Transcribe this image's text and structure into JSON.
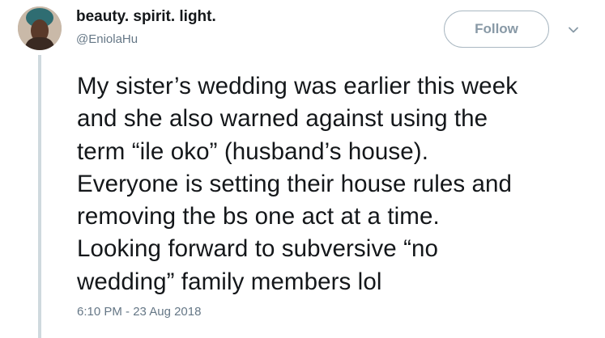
{
  "author": {
    "display_name": "beauty. spirit. light.",
    "handle": "@EniolaHu",
    "avatar_icon": "profile-photo"
  },
  "actions": {
    "follow_label": "Follow",
    "menu_icon": "chevron-down-icon"
  },
  "tweet": {
    "lines": [
      "My sister’s wedding was earlier this week",
      "and she also warned against using the",
      "term “ile oko” (husband’s house).",
      "Everyone is setting their house rules and",
      "removing the bs one act at a time.",
      "Looking forward to subversive “no",
      "wedding” family members lol"
    ],
    "timestamp": "6:10 PM - 23 Aug 2018"
  },
  "colors": {
    "text_primary": "#14171a",
    "text_secondary": "#657786",
    "thread_line": "#cfd9de",
    "follow_border": "#aab8c2"
  }
}
